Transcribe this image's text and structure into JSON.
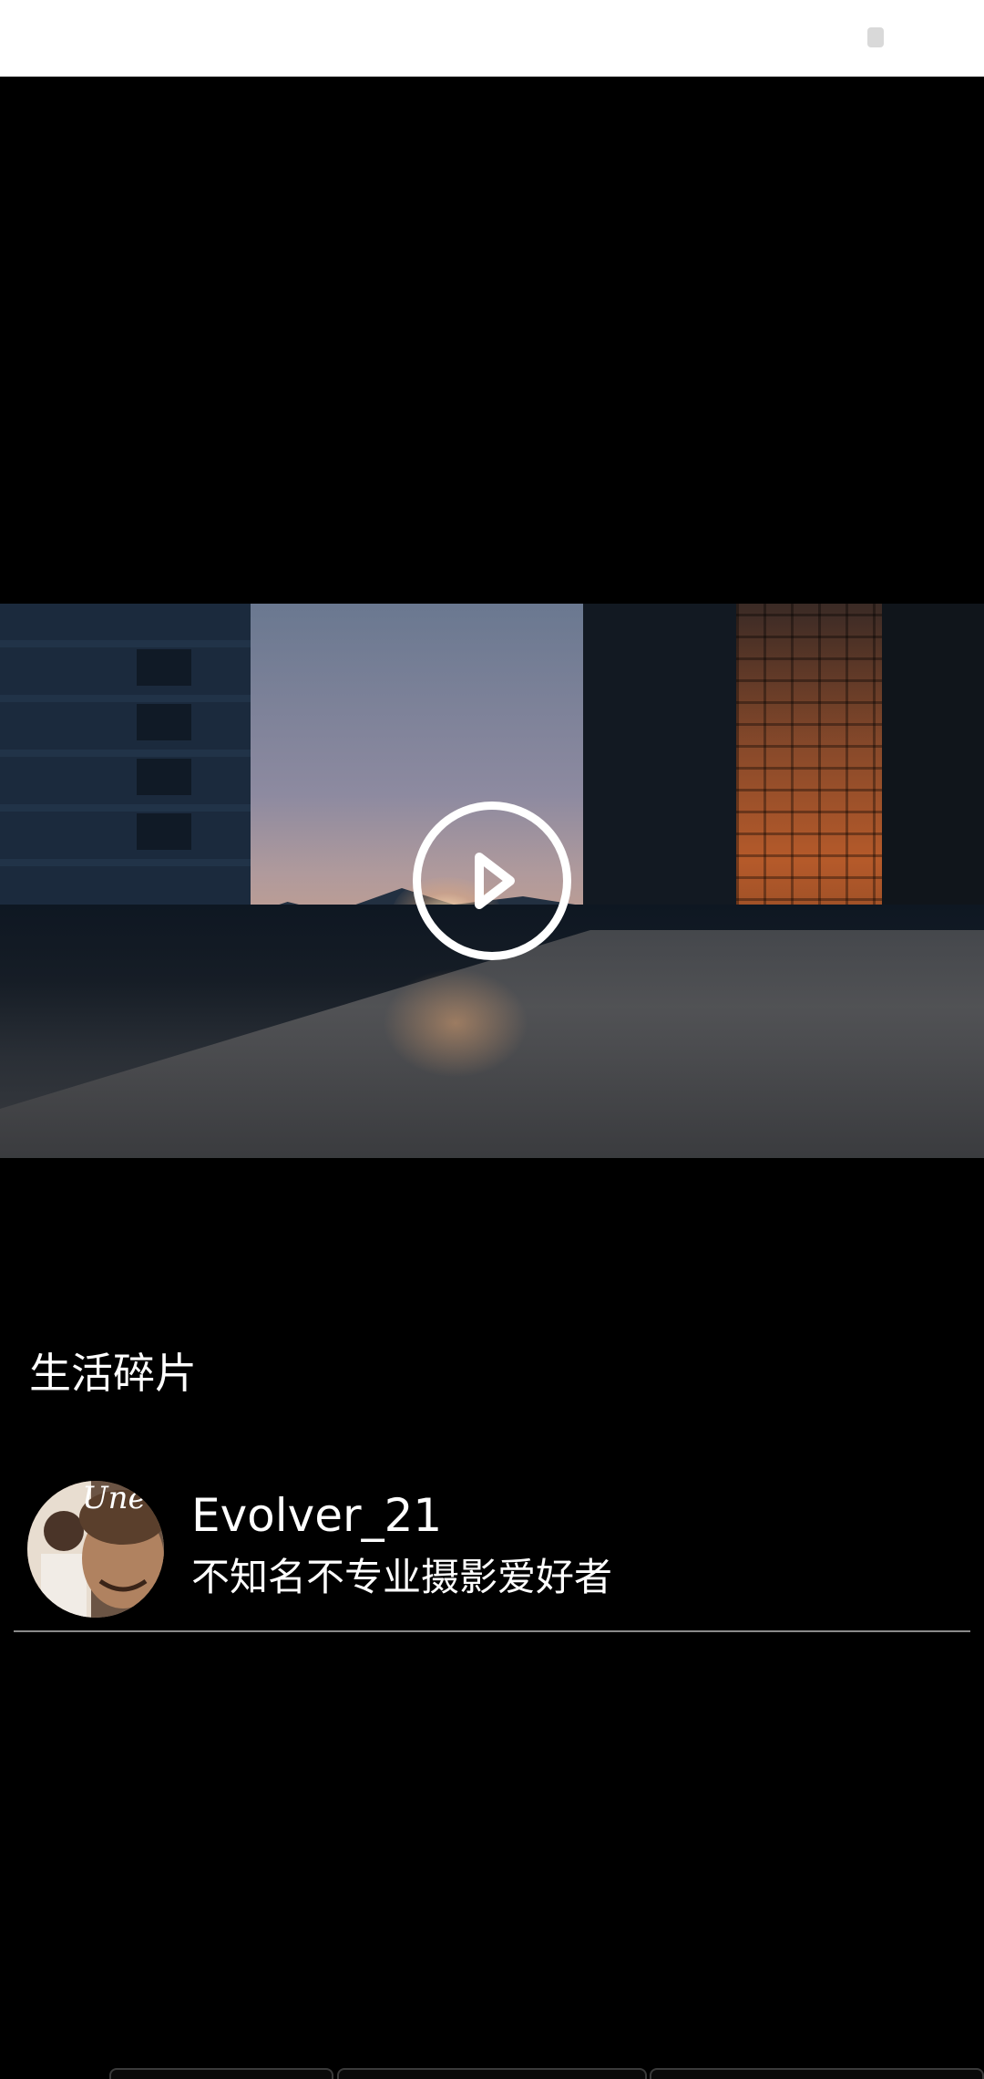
{
  "post": {
    "title": "生活碎片"
  },
  "author": {
    "name": "Evolver_21",
    "bio": "不知名不专业摄影爱好者",
    "avatar_text": "Une"
  },
  "icons": {
    "play": "play-icon",
    "status": "status-indicator-icon"
  }
}
